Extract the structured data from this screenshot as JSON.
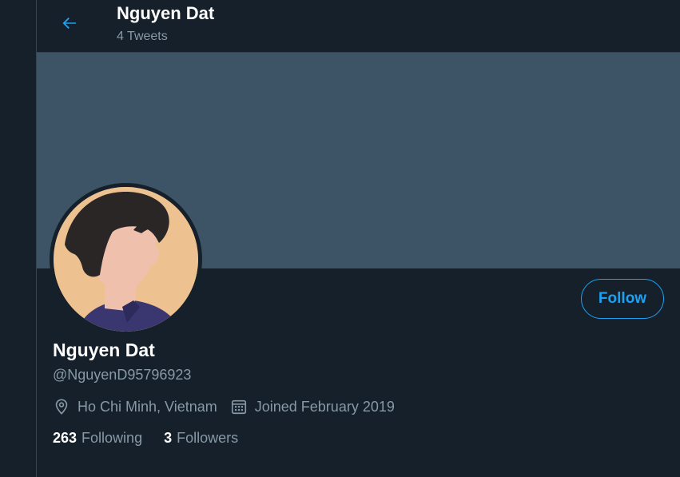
{
  "header": {
    "name": "Nguyen Dat",
    "tweet_count": "4 Tweets",
    "back_icon": "arrow-left-icon"
  },
  "profile": {
    "name": "Nguyen Dat",
    "handle": "@NguyenD95796923",
    "location": "Ho Chi Minh, Vietnam",
    "joined": "Joined February 2019",
    "location_icon": "location-pin-icon",
    "calendar_icon": "calendar-icon"
  },
  "follow_button": {
    "label": "Follow"
  },
  "stats": {
    "following_count": "263",
    "following_label": "Following",
    "followers_count": "3",
    "followers_label": "Followers"
  },
  "colors": {
    "background": "#15202b",
    "banner": "#3d5466",
    "accent": "#1da1f2",
    "secondary_text": "#8899a6",
    "border": "#38444d"
  }
}
